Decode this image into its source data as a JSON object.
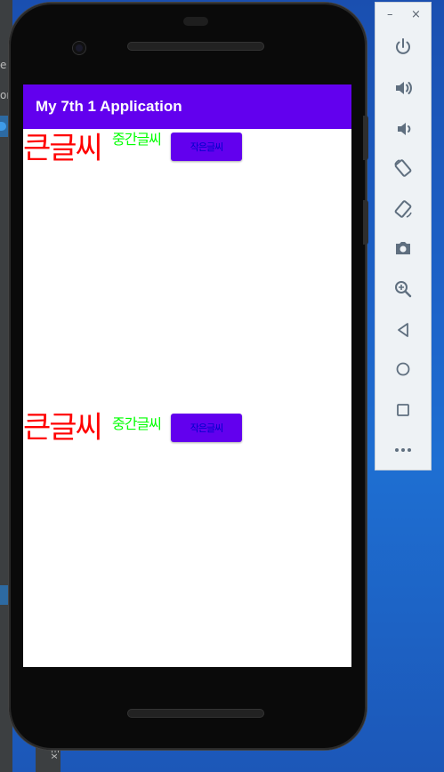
{
  "ide": {
    "fragments": [
      "e",
      "or"
    ],
    "bottom_tab": "Ex"
  },
  "app": {
    "title": "My 7th 1 Application",
    "rows": [
      {
        "big_text": "큰글씨",
        "mid_text": "중간글씨",
        "small_button": "작은글씨"
      },
      {
        "big_text": "큰글씨",
        "mid_text": "중간글씨",
        "small_button": "작은글씨"
      }
    ]
  },
  "emulator_toolbar": {
    "minimize_label": "–",
    "close_label": "×",
    "buttons": [
      "power-icon",
      "volume-up-icon",
      "volume-down-icon",
      "rotate-left-icon",
      "rotate-right-icon",
      "screenshot-camera-icon",
      "zoom-icon",
      "back-icon",
      "home-icon",
      "overview-icon",
      "more-icon"
    ]
  },
  "colors": {
    "app_bar": "#6200ee",
    "big_text": "#ff0000",
    "mid_text": "#00ff00",
    "button_text": "#0000cc",
    "icon": "#5f6f7f"
  }
}
